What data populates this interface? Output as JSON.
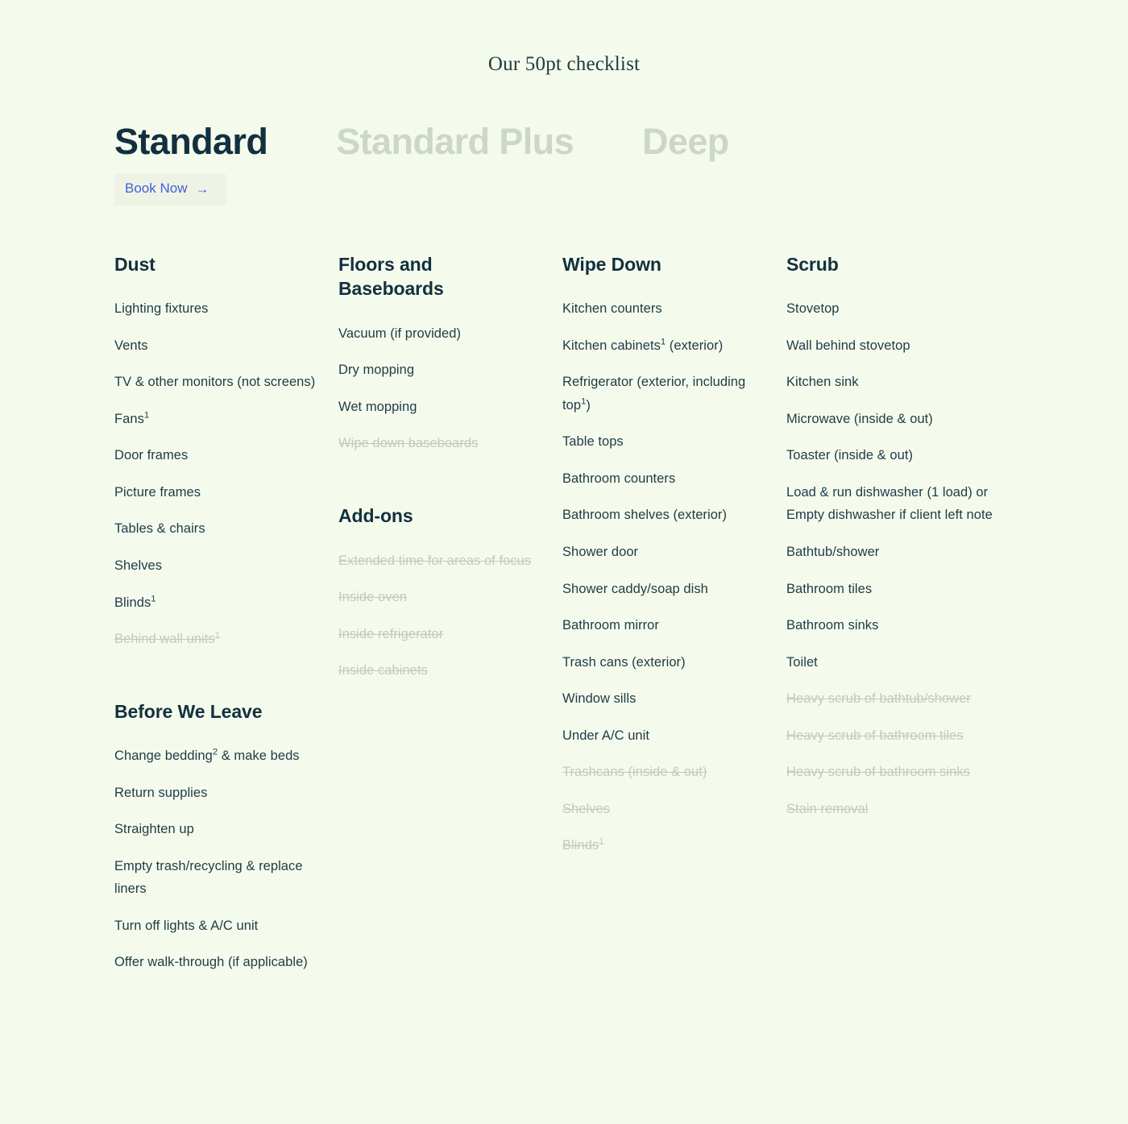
{
  "header": {
    "title": "Our 50pt checklist"
  },
  "tabs": [
    {
      "label": "Standard",
      "active": true
    },
    {
      "label": "Standard Plus",
      "active": false
    },
    {
      "label": "Deep",
      "active": false
    }
  ],
  "cta": {
    "label": "Book Now",
    "arrow": "→"
  },
  "colors": {
    "background": "#f5fbec",
    "heading": "#12303f",
    "body_text": "#1d3b48",
    "muted_strikethrough": "#bfcbbd",
    "inactive_tab": "#ccd7c9",
    "link_blue": "#4560d8",
    "cta_background": "#eef3e6"
  },
  "columns": [
    {
      "groups": [
        {
          "title": "Dust",
          "items": [
            {
              "text": "Lighting fixtures",
              "sup": "",
              "struck": false
            },
            {
              "text": "Vents",
              "sup": "",
              "struck": false
            },
            {
              "text": "TV & other monitors (not screens)",
              "sup": "",
              "struck": false
            },
            {
              "text": "Fans",
              "sup": "1",
              "struck": false
            },
            {
              "text": "Door frames",
              "sup": "",
              "struck": false
            },
            {
              "text": "Picture frames",
              "sup": "",
              "struck": false
            },
            {
              "text": "Tables & chairs",
              "sup": "",
              "struck": false
            },
            {
              "text": "Shelves",
              "sup": "",
              "struck": false
            },
            {
              "text": "Blinds",
              "sup": "1",
              "struck": false
            },
            {
              "text": "Behind wall units",
              "sup": "1",
              "struck": true
            }
          ]
        },
        {
          "title": "Before We Leave",
          "items": [
            {
              "text": "Change bedding",
              "sup": "2",
              "text_after": " & make beds",
              "struck": false
            },
            {
              "text": "Return supplies",
              "sup": "",
              "struck": false
            },
            {
              "text": "Straighten up",
              "sup": "",
              "struck": false
            },
            {
              "text": "Empty trash/recycling & replace liners",
              "sup": "",
              "struck": false
            },
            {
              "text": "Turn off lights & A/C unit",
              "sup": "",
              "struck": false
            },
            {
              "text": "Offer walk-through (if applicable)",
              "sup": "",
              "struck": false
            }
          ]
        }
      ]
    },
    {
      "groups": [
        {
          "title": "Floors and Baseboards",
          "items": [
            {
              "text": "Vacuum (if provided)",
              "sup": "",
              "struck": false
            },
            {
              "text": "Dry mopping",
              "sup": "",
              "struck": false
            },
            {
              "text": "Wet mopping",
              "sup": "",
              "struck": false
            },
            {
              "text": "Wipe down baseboards",
              "sup": "",
              "struck": true
            }
          ]
        },
        {
          "title": "Add-ons",
          "items": [
            {
              "text": "Extended time for areas of focus",
              "sup": "",
              "struck": true
            },
            {
              "text": "Inside oven",
              "sup": "",
              "struck": true
            },
            {
              "text": "Inside refrigerator",
              "sup": "",
              "struck": true
            },
            {
              "text": "Inside cabinets",
              "sup": "",
              "struck": true
            }
          ]
        }
      ]
    },
    {
      "groups": [
        {
          "title": "Wipe Down",
          "items": [
            {
              "text": "Kitchen counters",
              "sup": "",
              "struck": false
            },
            {
              "text": "Kitchen cabinets",
              "sup": "1",
              "text_after": " (exterior)",
              "struck": false
            },
            {
              "text": "Refrigerator (exterior, including top",
              "sup": "1",
              "text_after": ")",
              "struck": false
            },
            {
              "text": "Table tops",
              "sup": "",
              "struck": false
            },
            {
              "text": "Bathroom counters",
              "sup": "",
              "struck": false
            },
            {
              "text": "Bathroom shelves (exterior)",
              "sup": "",
              "struck": false
            },
            {
              "text": "Shower door",
              "sup": "",
              "struck": false
            },
            {
              "text": "Shower caddy/soap dish",
              "sup": "",
              "struck": false
            },
            {
              "text": "Bathroom mirror",
              "sup": "",
              "struck": false
            },
            {
              "text": "Trash cans (exterior)",
              "sup": "",
              "struck": false
            },
            {
              "text": "Window sills",
              "sup": "",
              "struck": false
            },
            {
              "text": "Under A/C unit",
              "sup": "",
              "struck": false
            },
            {
              "text": "Trashcans (inside & out)",
              "sup": "",
              "struck": true
            },
            {
              "text": "Shelves",
              "sup": "",
              "struck": true
            },
            {
              "text": "Blinds",
              "sup": "1",
              "struck": true
            }
          ]
        }
      ]
    },
    {
      "groups": [
        {
          "title": "Scrub",
          "items": [
            {
              "text": "Stovetop",
              "sup": "",
              "struck": false
            },
            {
              "text": "Wall behind stovetop",
              "sup": "",
              "struck": false
            },
            {
              "text": "Kitchen sink",
              "sup": "",
              "struck": false
            },
            {
              "text": "Microwave (inside & out)",
              "sup": "",
              "struck": false
            },
            {
              "text": "Toaster (inside & out)",
              "sup": "",
              "struck": false
            },
            {
              "text": "Load & run dishwasher (1 load) or Empty dishwasher if client left note",
              "sup": "",
              "struck": false
            },
            {
              "text": "Bathtub/shower",
              "sup": "",
              "struck": false
            },
            {
              "text": "Bathroom tiles",
              "sup": "",
              "struck": false
            },
            {
              "text": "Bathroom sinks",
              "sup": "",
              "struck": false
            },
            {
              "text": "Toilet",
              "sup": "",
              "struck": false
            },
            {
              "text": "Heavy scrub of bathtub/shower",
              "sup": "",
              "struck": true
            },
            {
              "text": "Heavy scrub of bathroom tiles",
              "sup": "",
              "struck": true
            },
            {
              "text": "Heavy scrub of bathroom sinks",
              "sup": "",
              "struck": true
            },
            {
              "text": "Stain removal",
              "sup": "",
              "struck": true
            }
          ]
        }
      ]
    }
  ]
}
